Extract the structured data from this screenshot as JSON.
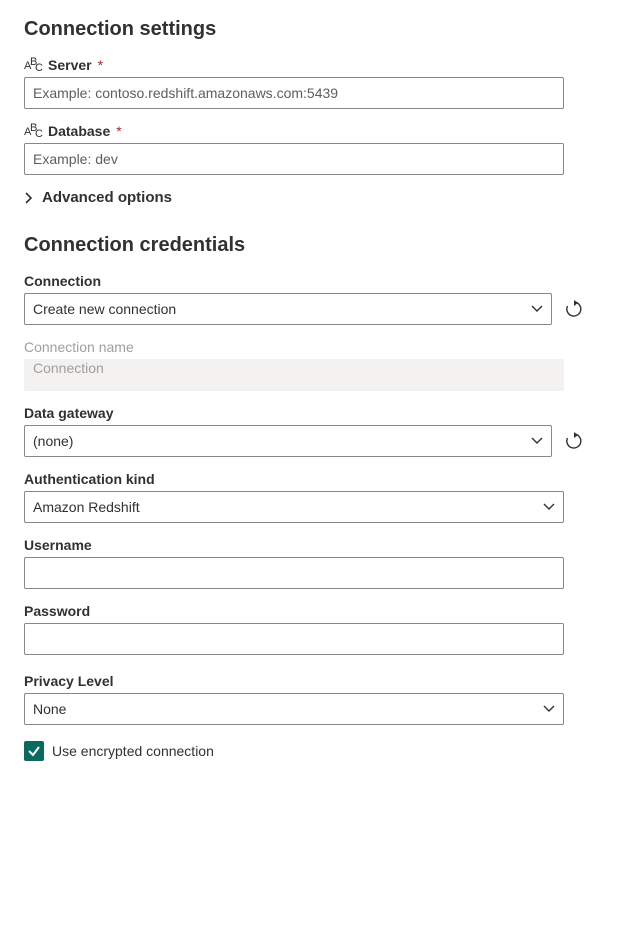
{
  "settings": {
    "heading": "Connection settings",
    "server": {
      "label": "Server",
      "placeholder": "Example: contoso.redshift.amazonaws.com:5439",
      "value": ""
    },
    "database": {
      "label": "Database",
      "placeholder": "Example: dev",
      "value": ""
    },
    "advanced_label": "Advanced options"
  },
  "credentials": {
    "heading": "Connection credentials",
    "connection": {
      "label": "Connection",
      "value": "Create new connection"
    },
    "connection_name": {
      "label": "Connection name",
      "placeholder": "Connection"
    },
    "data_gateway": {
      "label": "Data gateway",
      "value": "(none)"
    },
    "auth_kind": {
      "label": "Authentication kind",
      "value": "Amazon Redshift"
    },
    "username": {
      "label": "Username",
      "value": ""
    },
    "password": {
      "label": "Password",
      "value": ""
    },
    "privacy": {
      "label": "Privacy Level",
      "value": "None"
    },
    "encrypted_label": "Use encrypted connection"
  }
}
